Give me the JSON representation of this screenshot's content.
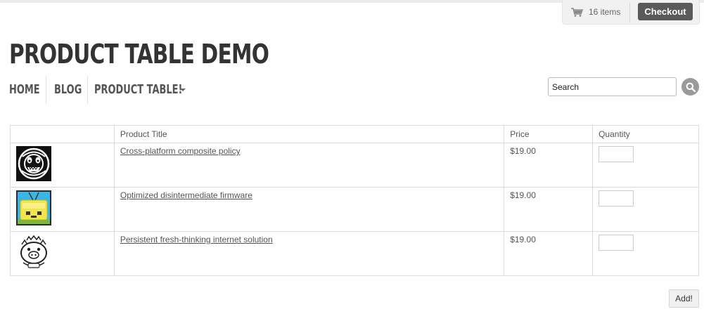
{
  "header": {
    "cart_count": "16 items",
    "checkout_label": "Checkout",
    "site_title": "PRODUCT TABLE DEMO"
  },
  "nav": {
    "items": [
      {
        "label": "HOME"
      },
      {
        "label": "BLOG"
      },
      {
        "label": "PRODUCT TABLE!"
      }
    ]
  },
  "search": {
    "placeholder": "Search",
    "icon": "search-icon"
  },
  "table": {
    "headers": [
      "",
      "Product Title",
      "Price",
      "Quantity"
    ],
    "rows": [
      {
        "title": "Cross-platform composite policy",
        "price": "$19.00",
        "quantity": "",
        "icon": "bw-monster-logo"
      },
      {
        "title": "Optimized disintermediate firmware",
        "price": "$19.00",
        "quantity": "",
        "icon": "yellow-radio-character"
      },
      {
        "title": "Persistent fresh-thinking internet solution",
        "price": "$19.00",
        "quantity": "",
        "icon": "pig-character"
      }
    ]
  },
  "actions": {
    "add_label": "Add!"
  },
  "colors": {
    "checkout_bg": "#5a5a5a",
    "title_text": "#333333",
    "nav_text": "#555555",
    "search_button": "#9a9a9a",
    "table_border": "#dcdcdc"
  }
}
